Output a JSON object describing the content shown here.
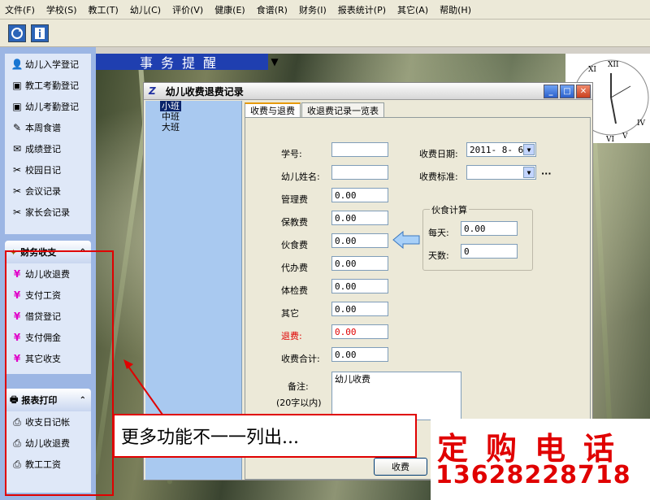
{
  "menu": [
    "文件(F)",
    "学校(S)",
    "教工(T)",
    "幼儿(C)",
    "评价(V)",
    "健康(E)",
    "食谱(R)",
    "财务(I)",
    "报表统计(P)",
    "其它(A)",
    "帮助(H)"
  ],
  "toolbar": {
    "icons": [
      "refresh-icon",
      "info-icon"
    ]
  },
  "remind": {
    "label": "事务提醒",
    "arrow": "▼"
  },
  "sidebar": {
    "top_items": [
      {
        "label": "幼儿入学登记",
        "icon": "enroll-icon"
      },
      {
        "label": "教工考勤登记",
        "icon": "attendance-icon"
      },
      {
        "label": "幼儿考勤登记",
        "icon": "attendance-icon"
      },
      {
        "label": "本周食谱",
        "icon": "pen-icon"
      },
      {
        "label": "成绩登记",
        "icon": "score-icon"
      },
      {
        "label": "校园日记",
        "icon": "tools-icon"
      },
      {
        "label": "会议记录",
        "icon": "tools-icon"
      },
      {
        "label": "家长会记录",
        "icon": "tools-icon"
      }
    ],
    "finance_header": "财务收支",
    "finance_items": [
      "幼儿收退费",
      "支付工资",
      "借贷登记",
      "支付佣金",
      "其它收支"
    ],
    "report_header": "报表打印",
    "report_items": [
      "收支日记帐",
      "幼儿收退费",
      "教工工资"
    ],
    "yen_symbol": "¥",
    "chevron": "⌃"
  },
  "dialog": {
    "title": "幼儿收费退费记录",
    "logo": "Z",
    "classes": [
      "小班",
      "中班",
      "大班"
    ],
    "tabs": [
      "收费与退费",
      "收退费记录一览表"
    ],
    "fields": {
      "student_no": {
        "label": "学号:",
        "value": ""
      },
      "child_name": {
        "label": "幼儿姓名:",
        "value": ""
      },
      "mgmt_fee": {
        "label": "管理费",
        "value": "0.00"
      },
      "care_fee": {
        "label": "保教费",
        "value": "0.00"
      },
      "meal_fee": {
        "label": "伙食费",
        "value": "0.00"
      },
      "agency_fee": {
        "label": "代办费",
        "value": "0.00"
      },
      "checkup_fee": {
        "label": "体检费",
        "value": "0.00"
      },
      "other_fee": {
        "label": "其它",
        "value": "0.00"
      },
      "refund": {
        "label": "退费:",
        "value": "0.00"
      },
      "total": {
        "label": "收费合计:",
        "value": "0.00"
      }
    },
    "date": {
      "label": "收费日期:",
      "value": "2011- 8- 6"
    },
    "standard": {
      "label": "收费标准:",
      "value": "",
      "ellipsis": "···"
    },
    "meal_calc": {
      "title": "伙食计算",
      "per_day_label": "每天:",
      "per_day_value": "0.00",
      "days_label": "天数:",
      "days_value": "0"
    },
    "remark": {
      "label": "备注:",
      "hint": "(20字以内)",
      "value": "幼儿收费"
    },
    "submit": "收费"
  },
  "callout": "更多功能不一一列出...",
  "order": {
    "label": "定购电话",
    "phone": "13628228718"
  },
  "colors": {
    "highlight": "#e00000",
    "sidebar": "#9cb6e4",
    "title_bar": "#1f3fb0"
  }
}
